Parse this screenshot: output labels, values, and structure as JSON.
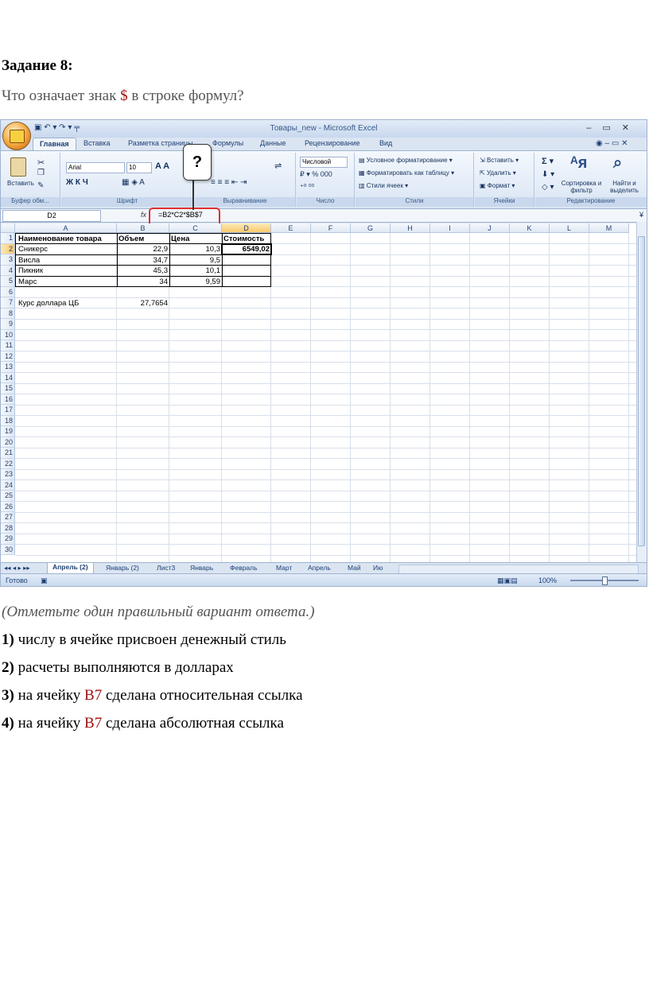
{
  "task": {
    "heading": "Задание 8:",
    "question_prefix": "Что означает знак ",
    "question_symbol": "$",
    "question_suffix": " в строке формул?"
  },
  "excel": {
    "window_title": "Товары_new - Microsoft Excel",
    "tabs": [
      "Главная",
      "Вставка",
      "Разметка страницы",
      "Формулы",
      "Данные",
      "Рецензирование",
      "Вид"
    ],
    "ribbon": {
      "paste_label": "Вставить",
      "clipboard_group": "Буфер обм...",
      "font_name": "Arial",
      "font_size": "10",
      "font_group": "Шрифт",
      "align_group": "Выравнивание",
      "number_format": "Числовой",
      "number_group": "Число",
      "cond_format": "Условное форматирование",
      "format_as_table": "Форматировать как таблицу",
      "cell_styles": "Стили ячеек",
      "styles_group": "Стили",
      "insert_cells": "Вставить",
      "delete_cells": "Удалить",
      "format_cells": "Формат",
      "cells_group": "Ячейки",
      "sort_filter": "Сортировка и фильтр",
      "find_select": "Найти и выделить",
      "editing_group": "Редактирование"
    },
    "name_box": "D2",
    "fx_label": "fx",
    "formula": "=B2*C2*$B$7",
    "callout_mark": "?",
    "columns": [
      "A",
      "B",
      "C",
      "D",
      "E",
      "F",
      "G",
      "H",
      "I",
      "J",
      "K",
      "L",
      "M"
    ],
    "rows": [
      "1",
      "2",
      "3",
      "4",
      "5",
      "6",
      "7",
      "8",
      "9",
      "10",
      "11",
      "12",
      "13",
      "14",
      "15",
      "16",
      "17",
      "18",
      "19",
      "20",
      "21",
      "22",
      "23",
      "24",
      "25",
      "26",
      "27",
      "28",
      "29",
      "30"
    ],
    "table_header": [
      "Наименование товара",
      "Объем",
      "Цена",
      "Стоимость"
    ],
    "table_rows": [
      [
        "Сникерс",
        "22,9",
        "10,3",
        "6549,02"
      ],
      [
        "Висла",
        "34,7",
        "9,5",
        ""
      ],
      [
        "Пикник",
        "45,3",
        "10,1",
        ""
      ],
      [
        "Марс",
        "34",
        "9,59",
        ""
      ]
    ],
    "rate_label": "Курс доллара ЦБ",
    "rate_value": "27,7654",
    "sheet_tabs": [
      "Апрель (2)",
      "Январь (2)",
      "Лист3",
      "Январь",
      "Февраль",
      "Март",
      "Апрель",
      "Май",
      "Ию"
    ],
    "status": "Готово",
    "zoom": "100%"
  },
  "answers": {
    "instruction": "(Отметьте один правильный вариант ответа.)",
    "options": [
      {
        "num": "1)",
        "text": "числу в ячейке присвоен денежный стиль",
        "ref": "",
        "rest": ""
      },
      {
        "num": "2)",
        "text": "расчеты выполняются в долларах",
        "ref": "",
        "rest": ""
      },
      {
        "num": "3)",
        "text": "на ячейку ",
        "ref": "В7",
        "rest": " сделана относительная ссылка"
      },
      {
        "num": "4)",
        "text": "на ячейку ",
        "ref": "В7",
        "rest": " сделана абсолютная ссылка"
      }
    ]
  }
}
